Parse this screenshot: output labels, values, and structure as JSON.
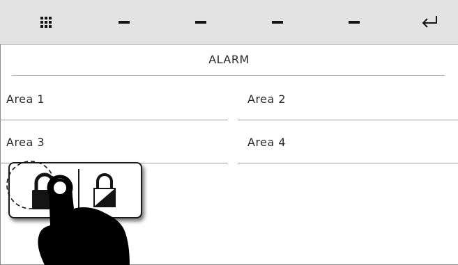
{
  "toolbar": {
    "items": [
      {
        "icon": "grid-menu-icon"
      },
      {
        "icon": "dash-icon"
      },
      {
        "icon": "dash-icon"
      },
      {
        "icon": "dash-icon"
      },
      {
        "icon": "dash-icon"
      },
      {
        "icon": "return-arrow-icon"
      }
    ]
  },
  "screen": {
    "title": "ALARM"
  },
  "areas": [
    {
      "label": "Area 1"
    },
    {
      "label": "Area 2"
    },
    {
      "label": "Area 3"
    },
    {
      "label": "Area 4"
    }
  ],
  "popup": {
    "left_icon": "lock-closed-icon",
    "right_icon": "lock-partial-icon"
  },
  "colors": {
    "toolbar_bg": "#e3e3e3",
    "text": "#2b2b2b",
    "icon": "#141414"
  }
}
